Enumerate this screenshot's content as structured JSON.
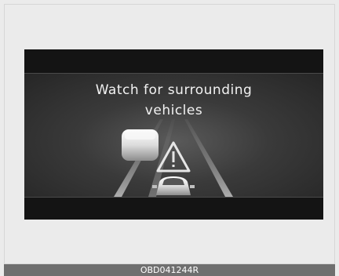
{
  "display": {
    "message_line1": "Watch for surrounding",
    "message_line2": "vehicles",
    "icons": [
      "front-vehicle-icon",
      "warning-triangle-icon",
      "own-vehicle-icon"
    ]
  },
  "caption": "OBD041244R",
  "colors": {
    "background": "#ebebeb",
    "display_bg": "#1c1c1c",
    "caption_bar": "#6f6f6f"
  }
}
